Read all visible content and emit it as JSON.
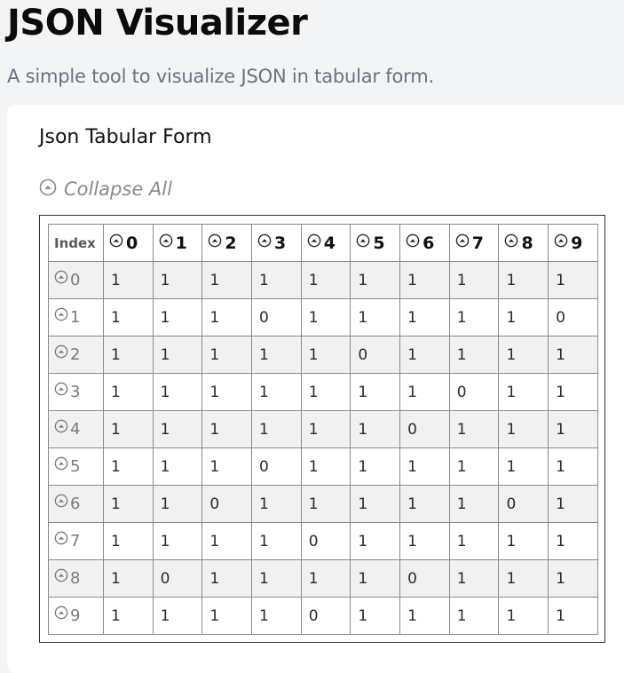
{
  "header": {
    "title": "JSON Visualizer",
    "subtitle": "A simple tool to visualize JSON in tabular form."
  },
  "card": {
    "title": "Json Tabular Form",
    "collapse_label": "Collapse All",
    "collapse_icon": "collapse-circle-icon"
  },
  "table": {
    "index_header": "Index",
    "columns": [
      "0",
      "1",
      "2",
      "3",
      "4",
      "5",
      "6",
      "7",
      "8",
      "9"
    ],
    "rows": [
      {
        "index": "0",
        "values": [
          "1",
          "1",
          "1",
          "1",
          "1",
          "1",
          "1",
          "1",
          "1",
          "1"
        ]
      },
      {
        "index": "1",
        "values": [
          "1",
          "1",
          "1",
          "0",
          "1",
          "1",
          "1",
          "1",
          "1",
          "0"
        ]
      },
      {
        "index": "2",
        "values": [
          "1",
          "1",
          "1",
          "1",
          "1",
          "0",
          "1",
          "1",
          "1",
          "1"
        ]
      },
      {
        "index": "3",
        "values": [
          "1",
          "1",
          "1",
          "1",
          "1",
          "1",
          "1",
          "0",
          "1",
          "1"
        ]
      },
      {
        "index": "4",
        "values": [
          "1",
          "1",
          "1",
          "1",
          "1",
          "1",
          "0",
          "1",
          "1",
          "1"
        ]
      },
      {
        "index": "5",
        "values": [
          "1",
          "1",
          "1",
          "0",
          "1",
          "1",
          "1",
          "1",
          "1",
          "1"
        ]
      },
      {
        "index": "6",
        "values": [
          "1",
          "1",
          "0",
          "1",
          "1",
          "1",
          "1",
          "1",
          "0",
          "1"
        ]
      },
      {
        "index": "7",
        "values": [
          "1",
          "1",
          "1",
          "1",
          "0",
          "1",
          "1",
          "1",
          "1",
          "1"
        ]
      },
      {
        "index": "8",
        "values": [
          "1",
          "0",
          "1",
          "1",
          "1",
          "1",
          "0",
          "1",
          "1",
          "1"
        ]
      },
      {
        "index": "9",
        "values": [
          "1",
          "1",
          "1",
          "1",
          "0",
          "1",
          "1",
          "1",
          "1",
          "1"
        ]
      }
    ]
  },
  "colors": {
    "page_bg": "#f3f4f6",
    "card_bg": "#ffffff",
    "stripe_bg": "#f1f1f1",
    "border": "#8a8a8a"
  }
}
